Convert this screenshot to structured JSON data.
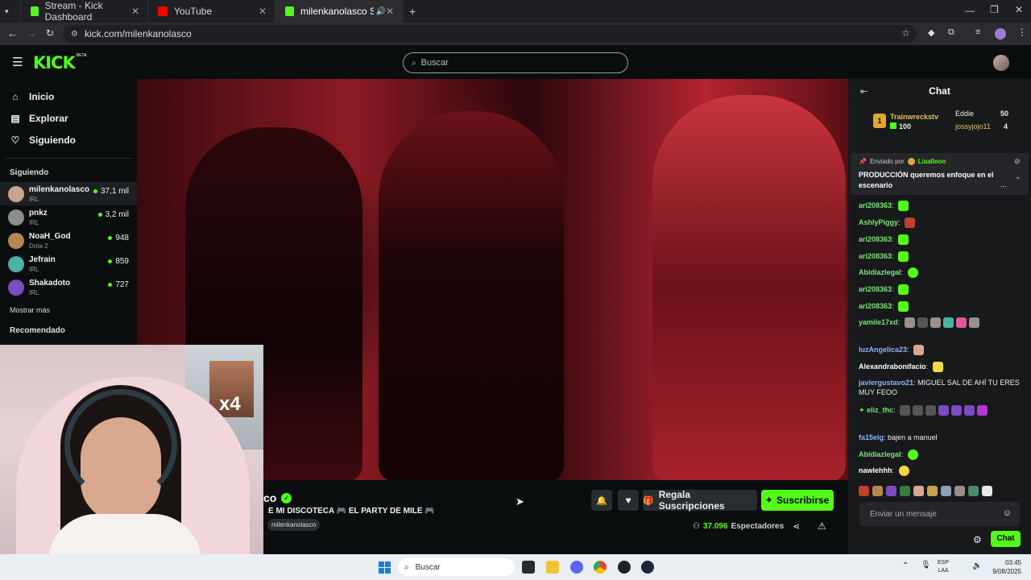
{
  "browser": {
    "tabs": [
      {
        "label": "Stream - Kick Dashboard"
      },
      {
        "label": "YouTube"
      },
      {
        "label": "milenkanolasco Stream - W"
      }
    ],
    "url": "kick.com/milenkanolasco"
  },
  "header": {
    "logo": "KICK",
    "logo_badge": "BETA",
    "search_placeholder": "Buscar"
  },
  "sidebar": {
    "nav": [
      {
        "label": "Inicio"
      },
      {
        "label": "Explorar"
      },
      {
        "label": "Siguiendo"
      }
    ],
    "following_title": "Siguiendo",
    "channels": [
      {
        "name": "milenkanolasco",
        "category": "IRL",
        "viewers": "37,1 mil",
        "color": "#c9a48c"
      },
      {
        "name": "pnkz",
        "category": "IRL",
        "viewers": "3,2 mil",
        "color": "#8d8d8d"
      },
      {
        "name": "NoaH_God",
        "category": "Dota 2",
        "viewers": "948",
        "color": "#b5874f"
      },
      {
        "name": "Jefrain",
        "category": "IRL",
        "viewers": "859",
        "color": "#4bb3a4"
      },
      {
        "name": "Shakadoto",
        "category": "IRL",
        "viewers": "727",
        "color": "#7b4cc2"
      }
    ],
    "show_more": "Mostrar más",
    "recommended_title": "Recomendado"
  },
  "stream": {
    "name_fragment": "co",
    "title": "E MI DISCOTECA 🎮 EL PARTY DE MILE 🎮",
    "tag": "milenkanolasco",
    "gift_label": "Regala Suscripciones",
    "subscribe_label": "Suscribirse",
    "viewers_count": "37.096",
    "viewers_label": "Espectadores",
    "webcam_badge": "x4"
  },
  "chat": {
    "title": "Chat",
    "leaderboard": [
      {
        "rank": "1",
        "name": "Trainwreckstv",
        "value": "100"
      },
      {
        "name": "Eddie",
        "value": "50"
      },
      {
        "name": "jossyjojo11",
        "value": "4"
      }
    ],
    "pinned": {
      "sent_by_label": "Enviado por",
      "sender": "Liaalleon",
      "text": "PRODUCCIÓN queremos enfoque en el escenario",
      "ellipsis": "..."
    },
    "messages": [
      {
        "user": "ari208363",
        "text": "",
        "color": "#7ee27a"
      },
      {
        "user": "AshlyPiggy",
        "text": "",
        "color": "#7ee27a"
      },
      {
        "user": "ari208363",
        "text": "",
        "color": "#7ee27a"
      },
      {
        "user": "ari208363",
        "text": "",
        "color": "#7ee27a"
      },
      {
        "user": "Abidiazlegal",
        "text": "",
        "color": "#7ee27a"
      },
      {
        "user": "ari208363",
        "text": "",
        "color": "#7ee27a"
      },
      {
        "user": "ari208363",
        "text": "",
        "color": "#7ee27a"
      },
      {
        "user": "yamile17xd",
        "text": "",
        "color": "#7ee27a"
      },
      {
        "user": "luzAngelica23",
        "text": "",
        "color": "#8ab4ff"
      },
      {
        "user": "Alexandrabonifacio",
        "text": "",
        "color": "#ffffff"
      },
      {
        "user": "javiergustavo21",
        "text": "MIGUEL SAL DE AHÍ TU ERES MUY FEOO",
        "color": "#8ab4ff"
      },
      {
        "user": "eliz_thc",
        "text": "",
        "color": "#7ee27a"
      },
      {
        "user": "fa15elg",
        "text": "bajen a manuel",
        "color": "#8ab4ff"
      },
      {
        "user": "Abidiazlegal",
        "text": "",
        "color": "#7ee27a"
      },
      {
        "user": "nawlehhh",
        "text": "",
        "color": "#ffffff"
      }
    ],
    "input_placeholder": "Enviar un mensaje",
    "send_label": "Chat"
  },
  "taskbar": {
    "search_placeholder": "Buscar",
    "lang_top": "ESP",
    "lang_bottom": "LAA",
    "time": "03:45",
    "date": "9/08/2025"
  },
  "colors": {
    "kick_green": "#53fc18",
    "bg": "#0b0e0f",
    "chat_bg": "#18191b"
  }
}
